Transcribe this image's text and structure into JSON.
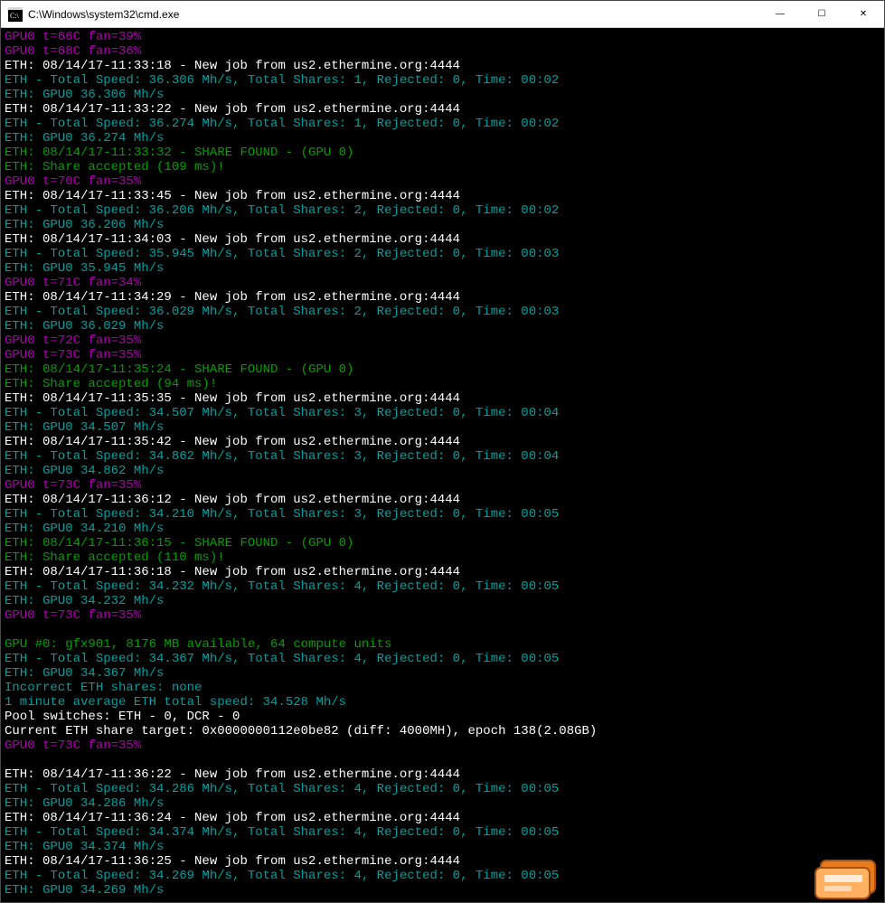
{
  "window": {
    "title": "C:\\Windows\\system32\\cmd.exe",
    "icon_label": "cmd-icon"
  },
  "controls": {
    "minimize": "—",
    "maximize": "☐",
    "close": "✕"
  },
  "lines": [
    {
      "cls": "c-magenta",
      "text": "GPU0 t=66C fan=39%"
    },
    {
      "cls": "c-magenta",
      "text": "GPU0 t=68C fan=36%"
    },
    {
      "cls": "c-white",
      "text": "ETH: 08/14/17-11:33:18 - New job from us2.ethermine.org:4444"
    },
    {
      "cls": "c-teal",
      "text": "ETH - Total Speed: 36.306 Mh/s, Total Shares: 1, Rejected: 0, Time: 00:02"
    },
    {
      "cls": "c-teal",
      "text": "ETH: GPU0 36.306 Mh/s"
    },
    {
      "cls": "c-white",
      "text": "ETH: 08/14/17-11:33:22 - New job from us2.ethermine.org:4444"
    },
    {
      "cls": "c-teal",
      "text": "ETH - Total Speed: 36.274 Mh/s, Total Shares: 1, Rejected: 0, Time: 00:02"
    },
    {
      "cls": "c-teal",
      "text": "ETH: GPU0 36.274 Mh/s"
    },
    {
      "cls": "c-green",
      "text": "ETH: 08/14/17-11:33:32 - SHARE FOUND - (GPU 0)"
    },
    {
      "cls": "c-green",
      "text": "ETH: Share accepted (109 ms)!"
    },
    {
      "cls": "c-magenta",
      "text": "GPU0 t=70C fan=35%"
    },
    {
      "cls": "c-white",
      "text": "ETH: 08/14/17-11:33:45 - New job from us2.ethermine.org:4444"
    },
    {
      "cls": "c-teal",
      "text": "ETH - Total Speed: 36.206 Mh/s, Total Shares: 2, Rejected: 0, Time: 00:02"
    },
    {
      "cls": "c-teal",
      "text": "ETH: GPU0 36.206 Mh/s"
    },
    {
      "cls": "c-white",
      "text": "ETH: 08/14/17-11:34:03 - New job from us2.ethermine.org:4444"
    },
    {
      "cls": "c-teal",
      "text": "ETH - Total Speed: 35.945 Mh/s, Total Shares: 2, Rejected: 0, Time: 00:03"
    },
    {
      "cls": "c-teal",
      "text": "ETH: GPU0 35.945 Mh/s"
    },
    {
      "cls": "c-magenta",
      "text": "GPU0 t=71C fan=34%"
    },
    {
      "cls": "c-white",
      "text": "ETH: 08/14/17-11:34:29 - New job from us2.ethermine.org:4444"
    },
    {
      "cls": "c-teal",
      "text": "ETH - Total Speed: 36.029 Mh/s, Total Shares: 2, Rejected: 0, Time: 00:03"
    },
    {
      "cls": "c-teal",
      "text": "ETH: GPU0 36.029 Mh/s"
    },
    {
      "cls": "c-magenta",
      "text": "GPU0 t=72C fan=35%"
    },
    {
      "cls": "c-magenta",
      "text": "GPU0 t=73C fan=35%"
    },
    {
      "cls": "c-green",
      "text": "ETH: 08/14/17-11:35:24 - SHARE FOUND - (GPU 0)"
    },
    {
      "cls": "c-green",
      "text": "ETH: Share accepted (94 ms)!"
    },
    {
      "cls": "c-white",
      "text": "ETH: 08/14/17-11:35:35 - New job from us2.ethermine.org:4444"
    },
    {
      "cls": "c-teal",
      "text": "ETH - Total Speed: 34.507 Mh/s, Total Shares: 3, Rejected: 0, Time: 00:04"
    },
    {
      "cls": "c-teal",
      "text": "ETH: GPU0 34.507 Mh/s"
    },
    {
      "cls": "c-white",
      "text": "ETH: 08/14/17-11:35:42 - New job from us2.ethermine.org:4444"
    },
    {
      "cls": "c-teal",
      "text": "ETH - Total Speed: 34.862 Mh/s, Total Shares: 3, Rejected: 0, Time: 00:04"
    },
    {
      "cls": "c-teal",
      "text": "ETH: GPU0 34.862 Mh/s"
    },
    {
      "cls": "c-magenta",
      "text": "GPU0 t=73C fan=35%"
    },
    {
      "cls": "c-white",
      "text": "ETH: 08/14/17-11:36:12 - New job from us2.ethermine.org:4444"
    },
    {
      "cls": "c-teal",
      "text": "ETH - Total Speed: 34.210 Mh/s, Total Shares: 3, Rejected: 0, Time: 00:05"
    },
    {
      "cls": "c-teal",
      "text": "ETH: GPU0 34.210 Mh/s"
    },
    {
      "cls": "c-green",
      "text": "ETH: 08/14/17-11:36:15 - SHARE FOUND - (GPU 0)"
    },
    {
      "cls": "c-green",
      "text": "ETH: Share accepted (110 ms)!"
    },
    {
      "cls": "c-white",
      "text": "ETH: 08/14/17-11:36:18 - New job from us2.ethermine.org:4444"
    },
    {
      "cls": "c-teal",
      "text": "ETH - Total Speed: 34.232 Mh/s, Total Shares: 4, Rejected: 0, Time: 00:05"
    },
    {
      "cls": "c-teal",
      "text": "ETH: GPU0 34.232 Mh/s"
    },
    {
      "cls": "c-magenta",
      "text": "GPU0 t=73C fan=35%"
    },
    {
      "cls": "c-gray",
      "text": ""
    },
    {
      "cls": "c-green",
      "text": "GPU #0: gfx901, 8176 MB available, 64 compute units"
    },
    {
      "cls": "c-teal",
      "text": "ETH - Total Speed: 34.367 Mh/s, Total Shares: 4, Rejected: 0, Time: 00:05"
    },
    {
      "cls": "c-teal",
      "text": "ETH: GPU0 34.367 Mh/s"
    },
    {
      "cls": "c-teal",
      "text": "Incorrect ETH shares: none"
    },
    {
      "cls": "c-teal",
      "text": "1 minute average ETH total speed: 34.528 Mh/s"
    },
    {
      "cls": "c-white",
      "text": "Pool switches: ETH - 0, DCR - 0"
    },
    {
      "cls": "c-white",
      "text": "Current ETH share target: 0x0000000112e0be82 (diff: 4000MH), epoch 138(2.08GB)"
    },
    {
      "cls": "c-magenta",
      "text": "GPU0 t=73C fan=35%"
    },
    {
      "cls": "c-gray",
      "text": ""
    },
    {
      "cls": "c-white",
      "text": "ETH: 08/14/17-11:36:22 - New job from us2.ethermine.org:4444"
    },
    {
      "cls": "c-teal",
      "text": "ETH - Total Speed: 34.286 Mh/s, Total Shares: 4, Rejected: 0, Time: 00:05"
    },
    {
      "cls": "c-teal",
      "text": "ETH: GPU0 34.286 Mh/s"
    },
    {
      "cls": "c-white",
      "text": "ETH: 08/14/17-11:36:24 - New job from us2.ethermine.org:4444"
    },
    {
      "cls": "c-teal",
      "text": "ETH - Total Speed: 34.374 Mh/s, Total Shares: 4, Rejected: 0, Time: 00:05"
    },
    {
      "cls": "c-teal",
      "text": "ETH: GPU0 34.374 Mh/s"
    },
    {
      "cls": "c-white",
      "text": "ETH: 08/14/17-11:36:25 - New job from us2.ethermine.org:4444"
    },
    {
      "cls": "c-teal",
      "text": "ETH - Total Speed: 34.269 Mh/s, Total Shares: 4, Rejected: 0, Time: 00:05"
    },
    {
      "cls": "c-teal",
      "text": "ETH: GPU0 34.269 Mh/s"
    }
  ]
}
